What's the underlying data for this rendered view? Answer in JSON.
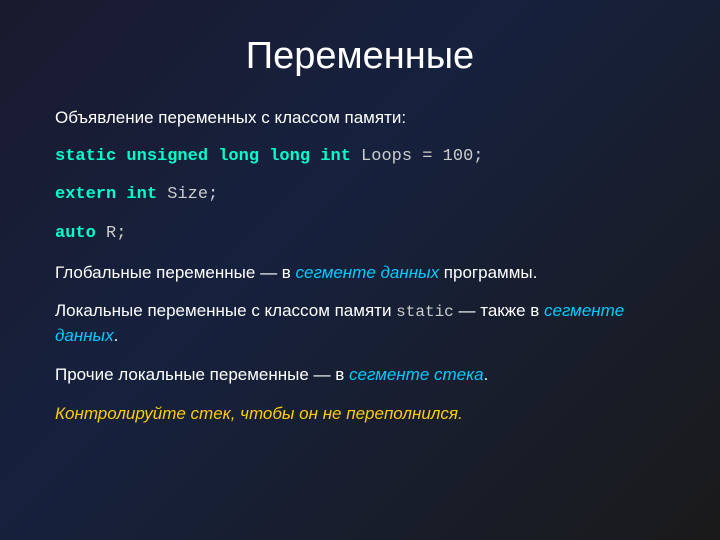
{
  "title": "Переменные",
  "intro": "Объявление переменных с классом памяти:",
  "code1": {
    "kw1": "static unsigned long long int",
    "rest": " Loops = 100;"
  },
  "code2": {
    "kw1": "extern",
    "kw2": " int",
    "rest": " Size;"
  },
  "code3": {
    "kw1": "auto",
    "rest": " R;"
  },
  "para1_before": "Глобальные переменные — в ",
  "para1_highlight": "сегменте данных",
  "para1_after": " программы.",
  "para2_before": "Локальные переменные с классом памяти ",
  "para2_code": "static",
  "para2_middle": " — также в ",
  "para2_highlight": "сегменте данных",
  "para2_after": ".",
  "para3_before": "Прочие локальные переменные — в ",
  "para3_highlight": "сегменте стека",
  "para3_after": ".",
  "warning": "Контролируйте стек, чтобы он не переполнился."
}
